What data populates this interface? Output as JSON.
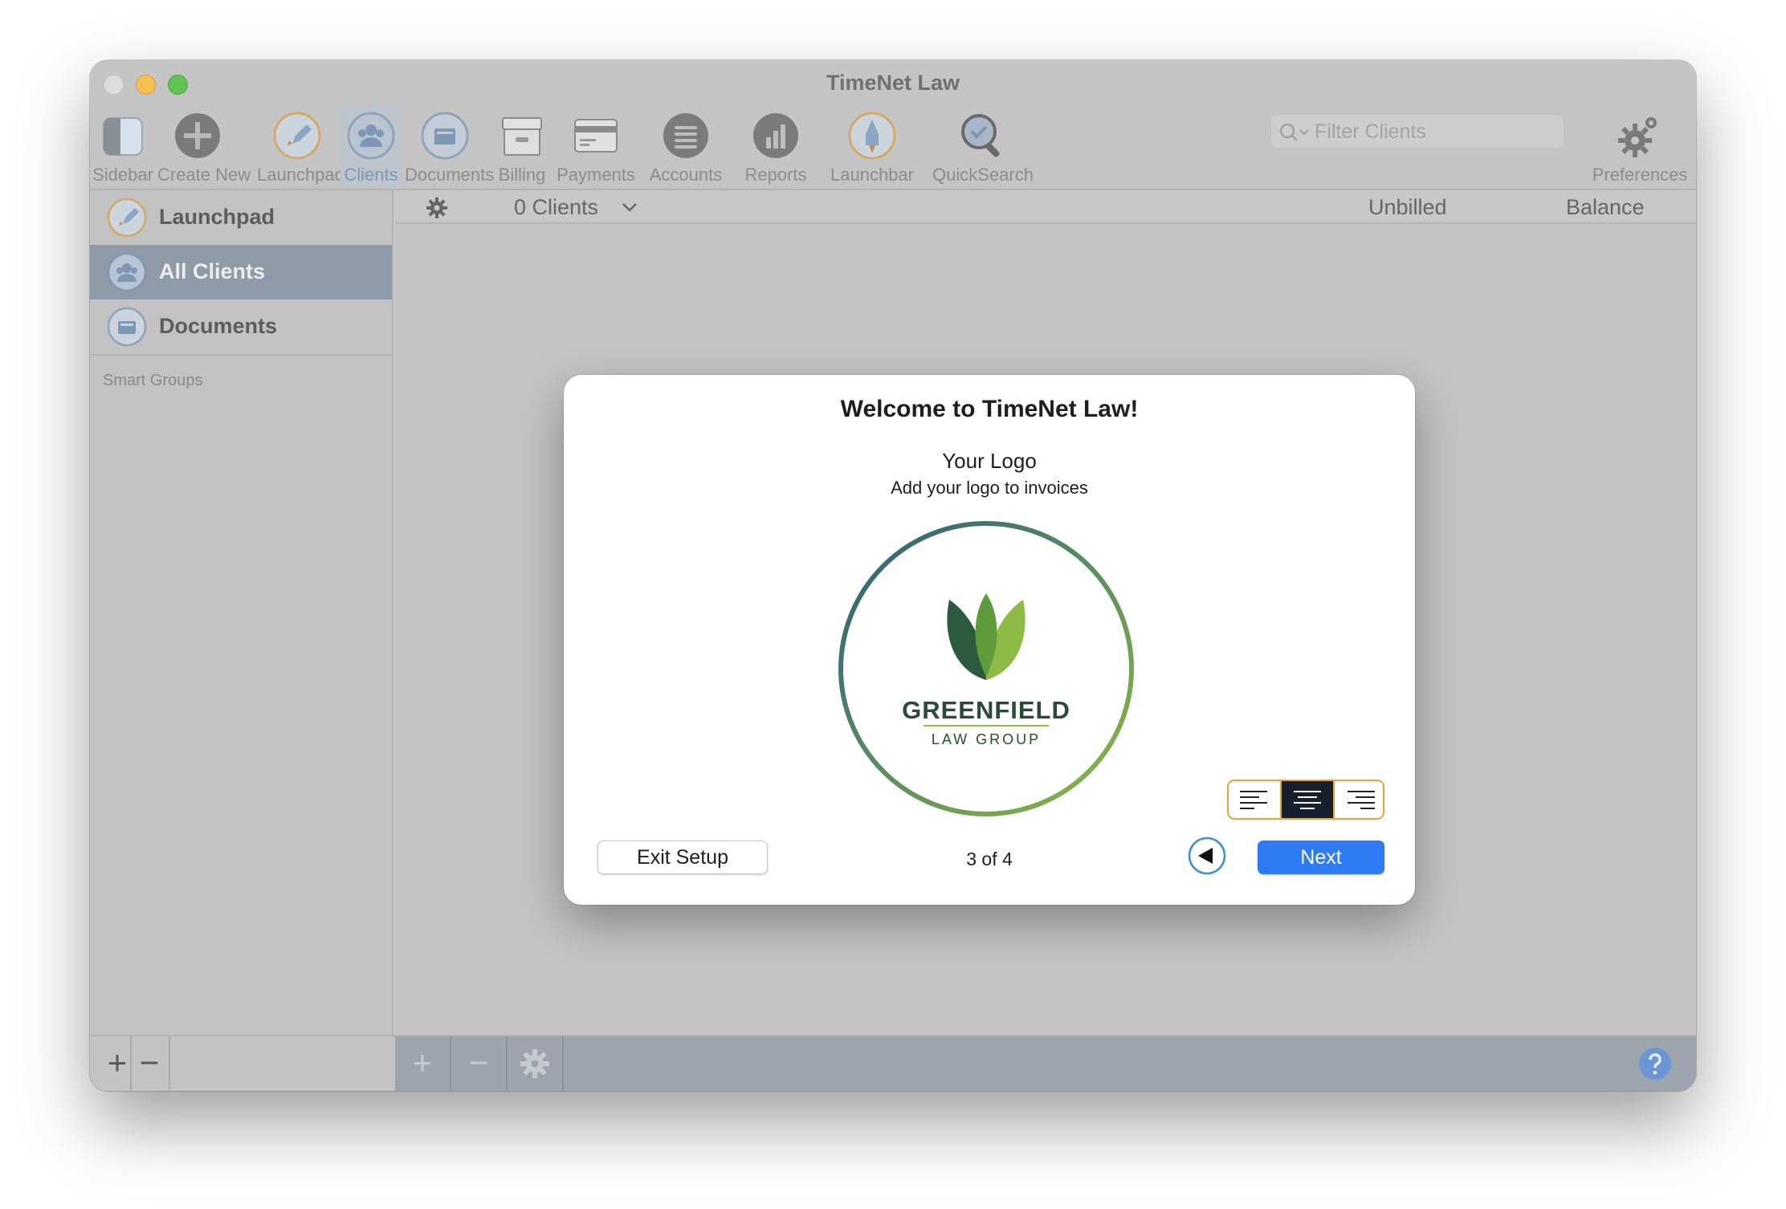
{
  "window": {
    "title": "TimeNet Law"
  },
  "toolbar": {
    "items": [
      {
        "label": "Sidebar"
      },
      {
        "label": "Create New"
      },
      {
        "label": "Launchpad"
      },
      {
        "label": "Clients"
      },
      {
        "label": "Documents"
      },
      {
        "label": "Billing"
      },
      {
        "label": "Payments"
      },
      {
        "label": "Accounts"
      },
      {
        "label": "Reports"
      },
      {
        "label": "Launchbar"
      },
      {
        "label": "QuickSearch"
      },
      {
        "label": "Preferences"
      }
    ],
    "active": "Clients",
    "search_placeholder": "Filter Clients"
  },
  "sidebar": {
    "items": [
      {
        "label": "Launchpad",
        "icon": "rocket-icon"
      },
      {
        "label": "All Clients",
        "icon": "clients-icon",
        "selected": true
      },
      {
        "label": "Documents",
        "icon": "documents-icon"
      }
    ],
    "section_label": "Smart Groups"
  },
  "list": {
    "count_label": "0 Clients",
    "columns": [
      "Unbilled",
      "Balance"
    ]
  },
  "bottombar": {
    "left": [
      "+",
      "−"
    ],
    "right": [
      "+",
      "−"
    ]
  },
  "modal": {
    "title": "Welcome to TimeNet Law!",
    "step_title": "Your Logo",
    "step_description": "Add your logo to invoices",
    "logo_text_main": "GREENFIELD",
    "logo_text_sub": "LAW GROUP",
    "alignment_options": [
      "left",
      "center",
      "right"
    ],
    "alignment_selected": "center",
    "exit_label": "Exit Setup",
    "pager": "3 of 4",
    "next_label": "Next"
  },
  "colors": {
    "accent_blue": "#2f7bf5",
    "alignment_border": "#e9a33c",
    "selected_sidebar": "#8e9aa8",
    "logo_dark_green": "#2b5a3f",
    "logo_light_green": "#8dbb45"
  }
}
